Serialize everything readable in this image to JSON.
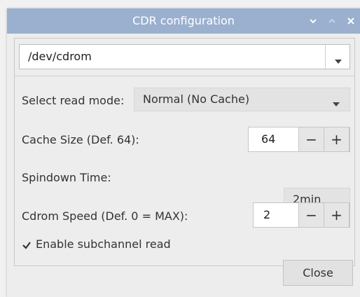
{
  "window": {
    "title": "CDR configuration"
  },
  "device": {
    "value": "/dev/cdrom"
  },
  "read_mode": {
    "label": "Select read mode:",
    "value": "Normal (No Cache)"
  },
  "cache_size": {
    "label": "Cache Size (Def. 64):",
    "value": "64",
    "minus": "−",
    "plus": "+"
  },
  "spindown": {
    "label": "Spindown Time:",
    "value": "2min"
  },
  "cdrom_speed": {
    "label": "Cdrom Speed (Def. 0 = MAX):",
    "value": "2",
    "minus": "−",
    "plus": "+"
  },
  "subchannel": {
    "label": "Enable subchannel read",
    "checked": true
  },
  "close_button": "Close"
}
